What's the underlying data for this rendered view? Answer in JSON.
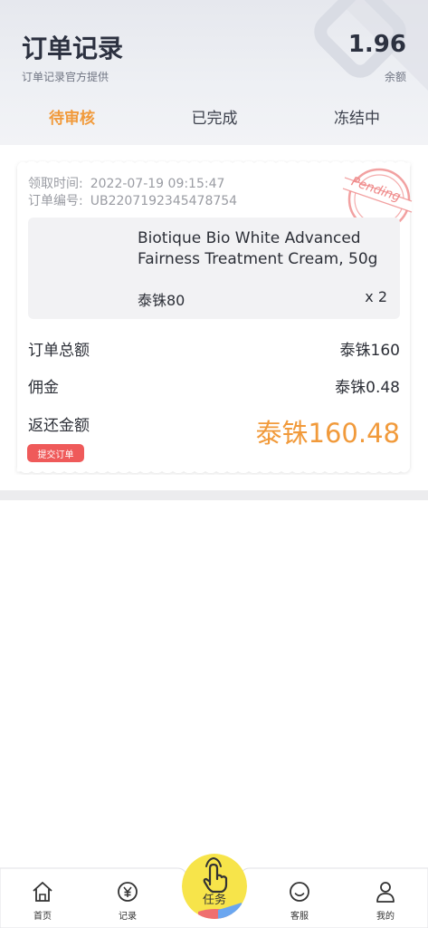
{
  "header": {
    "title": "订单记录",
    "subtitle": "订单记录官方提供",
    "balance_value": "1.96",
    "balance_label": "余额"
  },
  "tabs": [
    {
      "label": "待审核",
      "active": true
    },
    {
      "label": "已完成",
      "active": false
    },
    {
      "label": "冻结中",
      "active": false
    }
  ],
  "order": {
    "time_label": "领取时间:",
    "time_value": "2022-07-19 09:15:47",
    "id_label": "订单编号:",
    "id_value": "UB2207192345478754",
    "stamp_text": "Pending",
    "product": {
      "name": "Biotique Bio White Advanced Fairness Treatment Cream, 50g",
      "price": "泰铢80",
      "qty": "x 2"
    },
    "total_label": "订单总额",
    "total_value": "泰铢160",
    "commission_label": "佣金",
    "commission_value": "泰铢0.48",
    "return_label": "返还金额",
    "return_value": "泰铢160.48",
    "submit_label": "提交订单"
  },
  "nav": {
    "home": "首页",
    "records": "记录",
    "task": "任务",
    "service": "客服",
    "mine": "我的"
  },
  "colors": {
    "accent": "#f19a3b",
    "submit": "#ef5a5a",
    "stamp": "#ef8a8a",
    "task_button": "#f7e44a"
  }
}
